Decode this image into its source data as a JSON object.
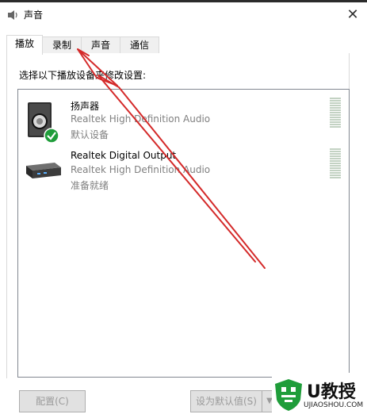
{
  "window": {
    "title": "声音"
  },
  "tabs": [
    {
      "label": "播放",
      "active": true
    },
    {
      "label": "录制",
      "active": false
    },
    {
      "label": "声音",
      "active": false
    },
    {
      "label": "通信",
      "active": false
    }
  ],
  "instruction": "选择以下播放设备来修改设置:",
  "devices": [
    {
      "name": "扬声器",
      "description": "Realtek High Definition Audio",
      "status": "默认设备",
      "icon": "speaker-icon",
      "default": true
    },
    {
      "name": "Realtek Digital Output",
      "description": "Realtek High Definition Audio",
      "status": "准备就绪",
      "icon": "digital-output-icon",
      "default": false
    }
  ],
  "buttons": {
    "configure": "配置(C)",
    "set_default": "设为默认值(S)"
  },
  "watermark": {
    "brand": "U教授",
    "site": "UJIAOSHOU.COM"
  },
  "colors": {
    "annotation_arrow": "#d42a2a",
    "check_badge": "#1f9d3a"
  }
}
